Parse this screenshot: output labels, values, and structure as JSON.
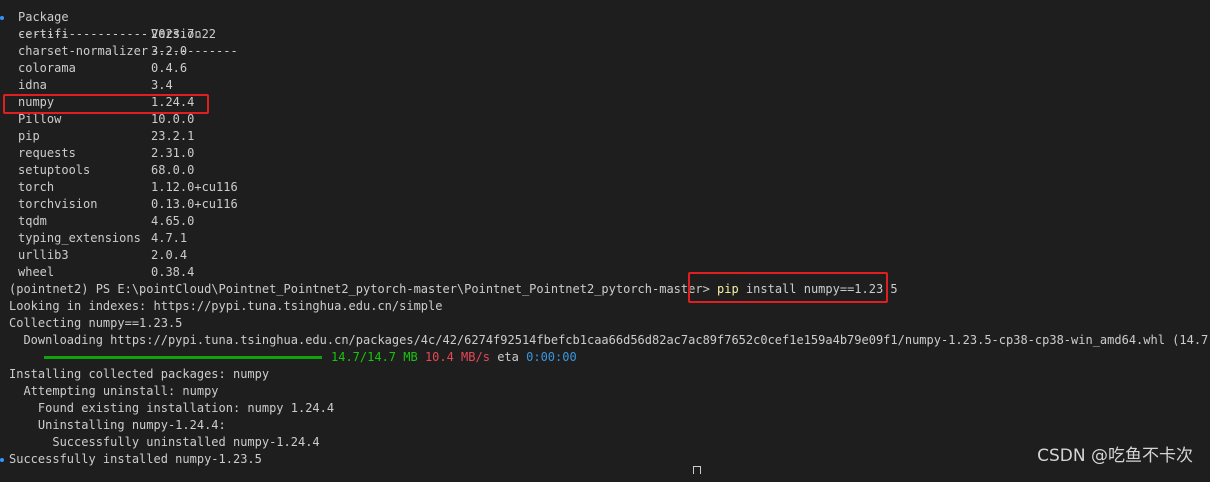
{
  "table": {
    "header_name": "Package",
    "header_version": "Version",
    "sep_name": "------------------",
    "sep_version": "------------",
    "packages": [
      {
        "name": "certifi",
        "version": "2023.7.22"
      },
      {
        "name": "charset-normalizer",
        "version": "3.2.0"
      },
      {
        "name": "colorama",
        "version": "0.4.6"
      },
      {
        "name": "idna",
        "version": "3.4"
      },
      {
        "name": "numpy",
        "version": "1.24.4"
      },
      {
        "name": "Pillow",
        "version": "10.0.0"
      },
      {
        "name": "pip",
        "version": "23.2.1"
      },
      {
        "name": "requests",
        "version": "2.31.0"
      },
      {
        "name": "setuptools",
        "version": "68.0.0"
      },
      {
        "name": "torch",
        "version": "1.12.0+cu116"
      },
      {
        "name": "torchvision",
        "version": "0.13.0+cu116"
      },
      {
        "name": "tqdm",
        "version": "4.65.0"
      },
      {
        "name": "typing_extensions",
        "version": "4.7.1"
      },
      {
        "name": "urllib3",
        "version": "2.0.4"
      },
      {
        "name": "wheel",
        "version": "0.38.4"
      }
    ]
  },
  "prompt": {
    "text": "(pointnet2) PS E:\\pointCloud\\Pointnet_Pointnet2_pytorch-master\\Pointnet_Pointnet2_pytorch-master> ",
    "cmd": "pip",
    "args": " install numpy==1.23.5"
  },
  "output": {
    "index": "Looking in indexes: https://pypi.tuna.tsinghua.edu.cn/simple",
    "collecting": "Collecting numpy==1.23.5",
    "downloading": "  Downloading https://pypi.tuna.tsinghua.edu.cn/packages/4c/42/6274f92514fbefcb1caa66d56d82ac7ac89f7652c0cef1e159a4b79e09f1/numpy-1.23.5-cp38-cp38-win_amd64.whl (14.7 MB)",
    "progress_fraction": 1.0,
    "progress_size": "14.7/14.7 MB",
    "progress_speed": "10.4 MB/s",
    "progress_eta_label": "eta",
    "progress_eta": "0:00:00",
    "installing": "Installing collected packages: numpy",
    "attempting": "  Attempting uninstall: numpy",
    "found": "    Found existing installation: numpy 1.24.4",
    "uninstalling": "    Uninstalling numpy-1.24.4:",
    "uninstalled": "      Successfully uninstalled numpy-1.24.4",
    "installed": "Successfully installed numpy-1.23.5"
  },
  "watermark": "CSDN @吃鱼不卡次",
  "colors": {
    "background": "#1e1e1e",
    "highlight_box": "#e02020",
    "progress_bar": "#13a10e",
    "pip_command": "#f9f1a5"
  }
}
